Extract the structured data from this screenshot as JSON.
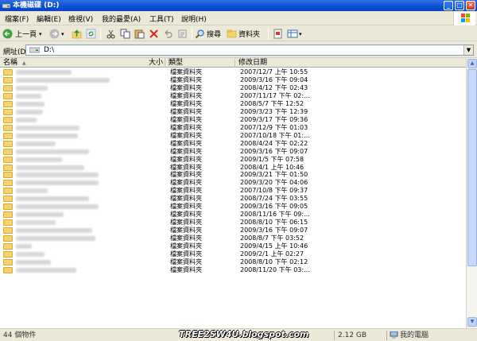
{
  "window": {
    "title": "本機磁碟 (D:)"
  },
  "menu": [
    "檔案(F)",
    "編輯(E)",
    "檢視(V)",
    "我的最愛(A)",
    "工具(T)",
    "說明(H)"
  ],
  "toolbar": {
    "back_label": "上一頁",
    "search_label": "搜尋",
    "folders_label": "資料夾"
  },
  "address": {
    "label": "網址(D)",
    "path": "D:\\"
  },
  "columns": {
    "name": "名稱",
    "size": "大小",
    "type": "類型",
    "date": "修改日期"
  },
  "files": [
    {
      "type": "檔案資料夾",
      "date": "2007/12/7 上午 10:55"
    },
    {
      "type": "檔案資料夾",
      "date": "2009/3/16 下午 09:04"
    },
    {
      "type": "檔案資料夾",
      "date": "2008/4/12 下午 02:43"
    },
    {
      "type": "檔案資料夾",
      "date": "2007/11/17 下午 02:..."
    },
    {
      "type": "檔案資料夾",
      "date": "2008/5/7 下午 12:52"
    },
    {
      "type": "檔案資料夾",
      "date": "2009/3/23 下午 12:39"
    },
    {
      "type": "檔案資料夾",
      "date": "2009/3/17 下午 09:36"
    },
    {
      "type": "檔案資料夾",
      "date": "2007/12/9 下午 01:03"
    },
    {
      "type": "檔案資料夾",
      "date": "2007/10/18 下午 01:..."
    },
    {
      "type": "檔案資料夾",
      "date": "2008/4/24 下午 02:22"
    },
    {
      "type": "檔案資料夾",
      "date": "2009/3/16 下午 09:07"
    },
    {
      "type": "檔案資料夾",
      "date": "2009/1/5 下午 07:58"
    },
    {
      "type": "檔案資料夾",
      "date": "2008/4/1 上午 10:46"
    },
    {
      "type": "檔案資料夾",
      "date": "2009/3/21 下午 01:50"
    },
    {
      "type": "檔案資料夾",
      "date": "2009/3/20 下午 04:06"
    },
    {
      "type": "檔案資料夾",
      "date": "2007/10/8 下午 09:37"
    },
    {
      "type": "檔案資料夾",
      "date": "2008/7/24 下午 03:55"
    },
    {
      "type": "檔案資料夾",
      "date": "2009/3/16 下午 09:05"
    },
    {
      "type": "檔案資料夾",
      "date": "2008/11/16 下午 09:..."
    },
    {
      "type": "檔案資料夾",
      "date": "2008/8/10 下午 06:15"
    },
    {
      "type": "檔案資料夾",
      "date": "2009/3/16 下午 09:07"
    },
    {
      "type": "檔案資料夾",
      "date": "2008/8/7 下午 03:52"
    },
    {
      "type": "檔案資料夾",
      "date": "2009/4/15 上午 10:46"
    },
    {
      "type": "檔案資料夾",
      "date": "2009/2/1 上午 02:27"
    },
    {
      "type": "檔案資料夾",
      "date": "2008/8/10 下午 02:12"
    },
    {
      "type": "檔案資料夾",
      "date": "2008/11/20 下午 03:..."
    }
  ],
  "status": {
    "count": "44 個物件",
    "size": "2.12 GB",
    "location": "我的電腦"
  },
  "watermark": "TREE2SW4U.blogspot.com"
}
